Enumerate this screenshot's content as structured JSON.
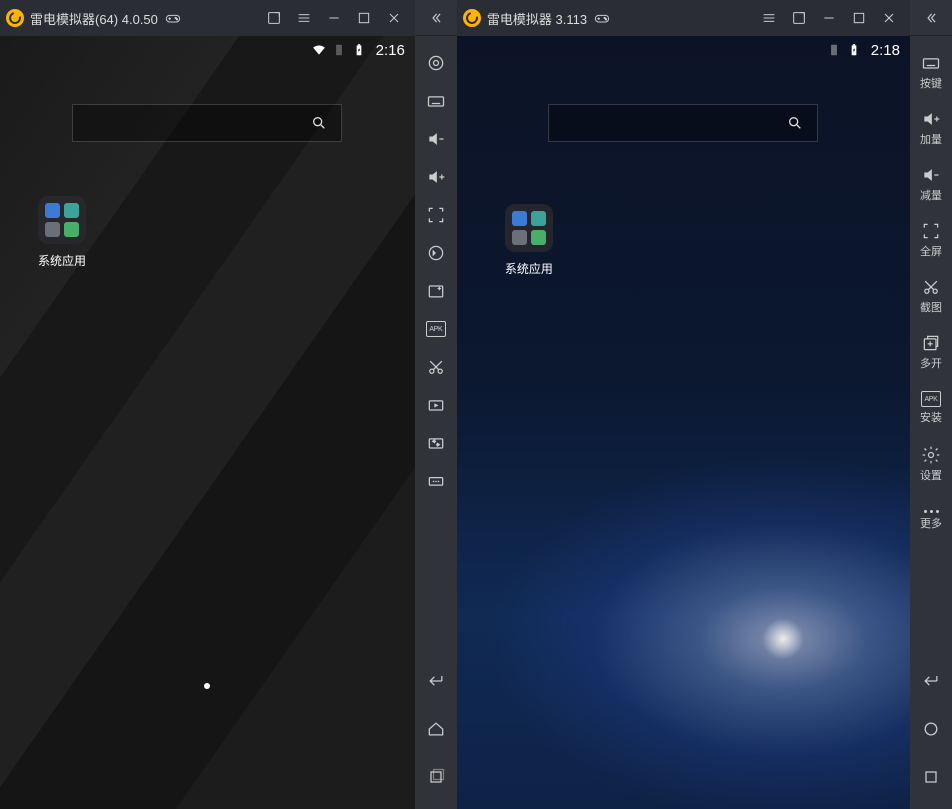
{
  "left": {
    "title": "雷电模拟器(64) 4.0.50",
    "status": {
      "time": "2:16"
    },
    "folder_label": "系统应用",
    "sidebar": {
      "gear": "",
      "keyboard": "",
      "vol_down": "",
      "vol_up": "",
      "fullscreen": "",
      "rotate": "",
      "screenshot": "",
      "apk": "APK",
      "scissors": "",
      "video": "",
      "transfer": "",
      "more": "",
      "back": "",
      "home": "",
      "recent": ""
    }
  },
  "right": {
    "title": "雷电模拟器 3.113",
    "status": {
      "time": "2:18"
    },
    "folder_label": "系统应用",
    "sidebar": {
      "keyboard_label": "按键",
      "volup_label": "加量",
      "voldown_label": "减量",
      "fullscreen_label": "全屏",
      "screenshot_label": "截图",
      "multi_label": "多开",
      "install_label": "安装",
      "apk_text": "APK",
      "settings_label": "设置",
      "more_label": "更多"
    }
  }
}
